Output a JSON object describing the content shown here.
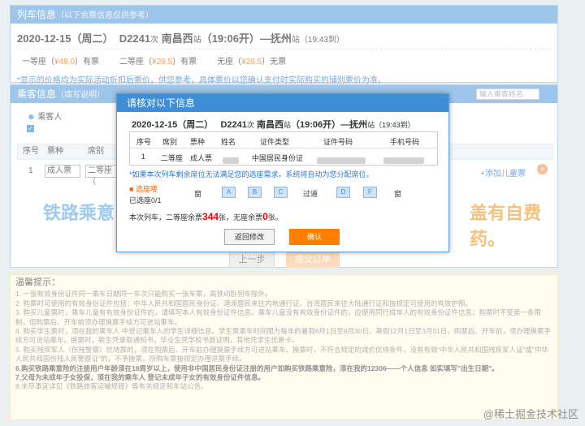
{
  "train_panel": {
    "title": "列车信息",
    "subtitle": "（以下余票信息仅供参考）",
    "date": "2020-12-15（周二）",
    "train_no": "D2241",
    "train_suffix": "次",
    "from": "南昌西",
    "from_suffix": "站",
    "time": "（19:06开）—抚州",
    "to_suffix": "站",
    "arrive": "（19:43到）",
    "seat1": "一等座（",
    "seat1_price": "¥48.0",
    "seat1_rest": "）有票",
    "seat2": "二等座（",
    "seat2_price": "¥29.5",
    "seat2_rest": "）有票",
    "seat3": "无座（",
    "seat3_price": "¥29.5",
    "seat3_rest": "）无票",
    "note": "*显示的价格均为实际活动折扣后票价，供您参考，具体票价以您确认支付时实际购买的铺别票价为准。"
  },
  "passenger_panel": {
    "title": "乘客信息",
    "subtitle": "（填写说明）",
    "search_placeholder": "输入乘客姓名",
    "passenger_label": "乘客人",
    "col_seq": "序号",
    "col_ticket": "票种",
    "col_seat": "席别",
    "row_seq": "1",
    "row_ticket": "成人票",
    "row_seat": "二等座（",
    "add_child": "添加儿童票",
    "ad_left": "铁路乘意",
    "ad_right": "盖有自费药。"
  },
  "buttons": {
    "prev": "上一步",
    "submit": "提交订单"
  },
  "modal": {
    "title": "请核对以下信息",
    "date": "2020-12-15（周二）",
    "train_no": "D2241",
    "train_suffix": "次",
    "from": "南昌西",
    "from_suffix": "站",
    "time": "（19:06开）—抚州",
    "to_suffix": "站",
    "arrive": "（19:43到）",
    "headers": [
      "序号",
      "席别",
      "票种",
      "姓名",
      "证件类型",
      "证件号码",
      "手机号码"
    ],
    "row": {
      "seq": "1",
      "seat": "二等座",
      "ticket": "成人票",
      "id_type": "中国居民身份证"
    },
    "note": "*如果本次列车剩余席位无法满足您的选座需求，系统将自动为您分配席位。",
    "select_seat": "选座喽",
    "selected": "已选座0/1",
    "window_l": "窗",
    "aisle": "过道",
    "window_r": "窗",
    "seats": [
      "A",
      "B",
      "C",
      "D",
      "F"
    ],
    "remain_pre": "本次列车，二等座余票",
    "remain_num": "344",
    "remain_mid": "张，无座余票",
    "remain_zero": "0",
    "remain_post": "张。",
    "back": "返回修改",
    "confirm": "确认"
  },
  "tips": {
    "title": "温馨提示：",
    "lines": [
      "1. 一张有效身份证件同一乘车日期同一车次只能购买一张车票，高铁动卧列车除外。",
      "2. 购票时可使用的有效身份证件包括：中华人民共和国居民身份证、港澳居民来往内地通行证、台湾居民来往大陆通行证和按规定可使用的有效护照。",
      "3. 购买儿童票时，乘车儿童有有效身份证件的，请填写本人有效身份证件信息。乘车儿童没有有效身份证件的，应使用同行成年人的有效身份证件信息；购票时不受第一条限制，但购票后、开车前须办理换票手续方可进站乘车。",
      "4. 购买学生票时，须在我的乘车人 中登记乘车人的学生详细信息。学生票乘车时间限为每年的暑假6月1日至9月30日、寒假12月1日至3月31日。购票后、开车前，须办理换票手续方可进站乘车。换票时，新生凭录取通知书，毕业生凭学校书面证明，其他凭学生优惠卡。",
      "5. 购买残疾军人（伤残警察）优待票的，须在购票后、开车前办理换票手续方可进站乘车。换票时，不符合规定的减价优待条件，没有有效\"中华人民共和国残疾军人证\"或\"中华人民共和国伤残人民警察证\"的，不予换票，所购车票按规定办理退票手续。",
      "6.购买铁路乘意险的注册用户年龄须在18周岁以上，使用非中国居民身份证注册的用户如购买铁路乘意险，须在我的12306——个人信息 如实填写\"出生日期\"。",
      "7.父母为未成年子女投保，须在我的乘车人 登记未成年子女的有效身份证件信息。",
      "8.未尽事宜详见《铁路旅客运输规程》等有关规定和车站公告。"
    ]
  },
  "watermark": "@稀土掘金技术社区"
}
